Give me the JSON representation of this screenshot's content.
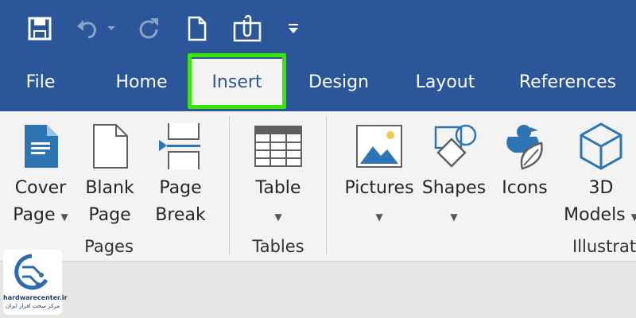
{
  "tabs": [
    "File",
    "Home",
    "Insert",
    "Design",
    "Layout",
    "References"
  ],
  "ribbon": {
    "cover_page": [
      "Cover",
      "Page"
    ],
    "blank_page": [
      "Blank",
      "Page"
    ],
    "page_break": [
      "Page",
      "Break"
    ],
    "table": "Table",
    "pictures": "Pictures",
    "shapes": "Shapes",
    "icons": "Icons",
    "models_3d": [
      "3D",
      "Models"
    ]
  },
  "groups": {
    "pages": "Pages",
    "tables": "Tables",
    "illustrations": "Illustrat"
  },
  "watermark": {
    "site": "hardwarecenter.ir",
    "tagline": "مرکز سخت افزار ایران"
  },
  "colors": {
    "titlebar": "#2b579a",
    "highlight": "#39e600",
    "ribbon": "#f3f3f3",
    "accent": "#2e75b6"
  }
}
